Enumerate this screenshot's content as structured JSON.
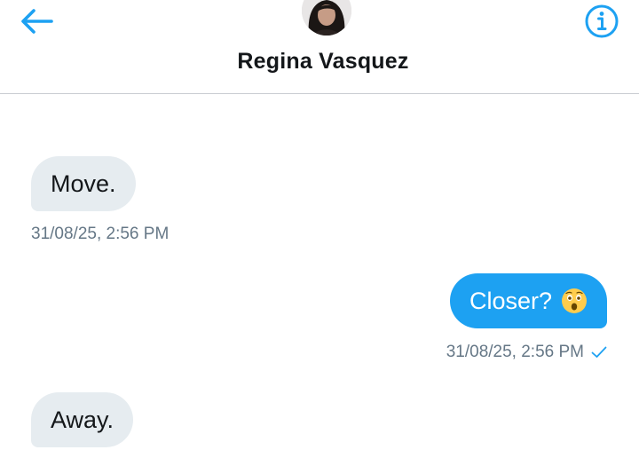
{
  "header": {
    "contact_name": "Regina Vasquez",
    "back_icon": "back-arrow-icon",
    "info_icon": "info-icon"
  },
  "messages": [
    {
      "direction": "incoming",
      "text": "Move.",
      "timestamp": "31/08/25, 2:56 PM"
    },
    {
      "direction": "outgoing",
      "text": "Closer?",
      "emoji": "astonished-face",
      "timestamp": "31/08/25, 2:56 PM",
      "status": "sent"
    },
    {
      "direction": "incoming",
      "text": "Away."
    }
  ],
  "colors": {
    "accent": "#1da1f2",
    "incoming_bubble": "#e6ecf0",
    "timestamp": "#657786"
  }
}
